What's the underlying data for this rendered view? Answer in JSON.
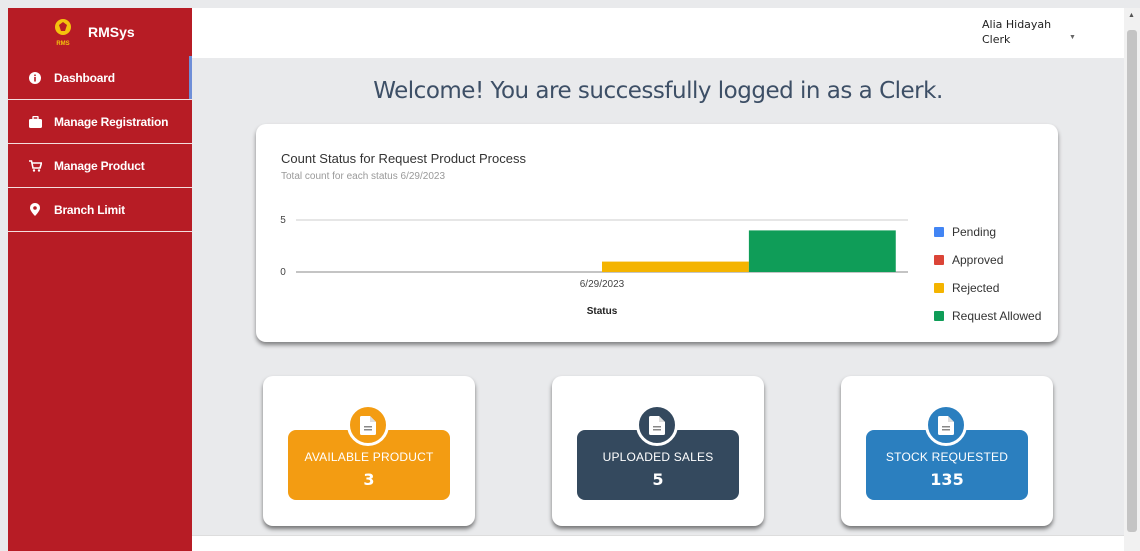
{
  "brand": {
    "name": "RMSys",
    "logo_text": "RMS"
  },
  "sidebar": {
    "items": [
      {
        "label": "Dashboard",
        "icon": "info-icon"
      },
      {
        "label": "Manage Registration",
        "icon": "briefcase-icon"
      },
      {
        "label": "Manage Product",
        "icon": "cart-icon"
      },
      {
        "label": "Branch Limit",
        "icon": "location-pin-icon"
      }
    ]
  },
  "user": {
    "name": "Alia Hidayah",
    "role": "Clerk"
  },
  "welcome": "Welcome! You are successfully logged in as a Clerk.",
  "chart_data": {
    "type": "bar",
    "title": "Count Status for Request Product Process",
    "subtitle": "Total count for each status 6/29/2023",
    "categories": [
      "6/29/2023"
    ],
    "xlabel": "Status",
    "ylabel": "",
    "ylim": [
      0,
      5
    ],
    "yticks": [
      "5",
      "0"
    ],
    "series": [
      {
        "name": "Pending",
        "values": [
          0
        ],
        "color": "#4285f4"
      },
      {
        "name": "Approved",
        "values": [
          0
        ],
        "color": "#db4437"
      },
      {
        "name": "Rejected",
        "values": [
          1
        ],
        "color": "#f4b400"
      },
      {
        "name": "Request Allowed",
        "values": [
          4
        ],
        "color": "#0f9d58"
      }
    ],
    "legend_position": "right"
  },
  "stats": [
    {
      "label": "AVAILABLE PRODUCT",
      "value": "3",
      "color": "#f39c12",
      "icon": "document-icon"
    },
    {
      "label": "UPLOADED SALES",
      "value": "5",
      "color": "#34495e",
      "icon": "document-icon"
    },
    {
      "label": "STOCK REQUESTED",
      "value": "135",
      "color": "#2b7fbf",
      "icon": "document-icon"
    }
  ]
}
